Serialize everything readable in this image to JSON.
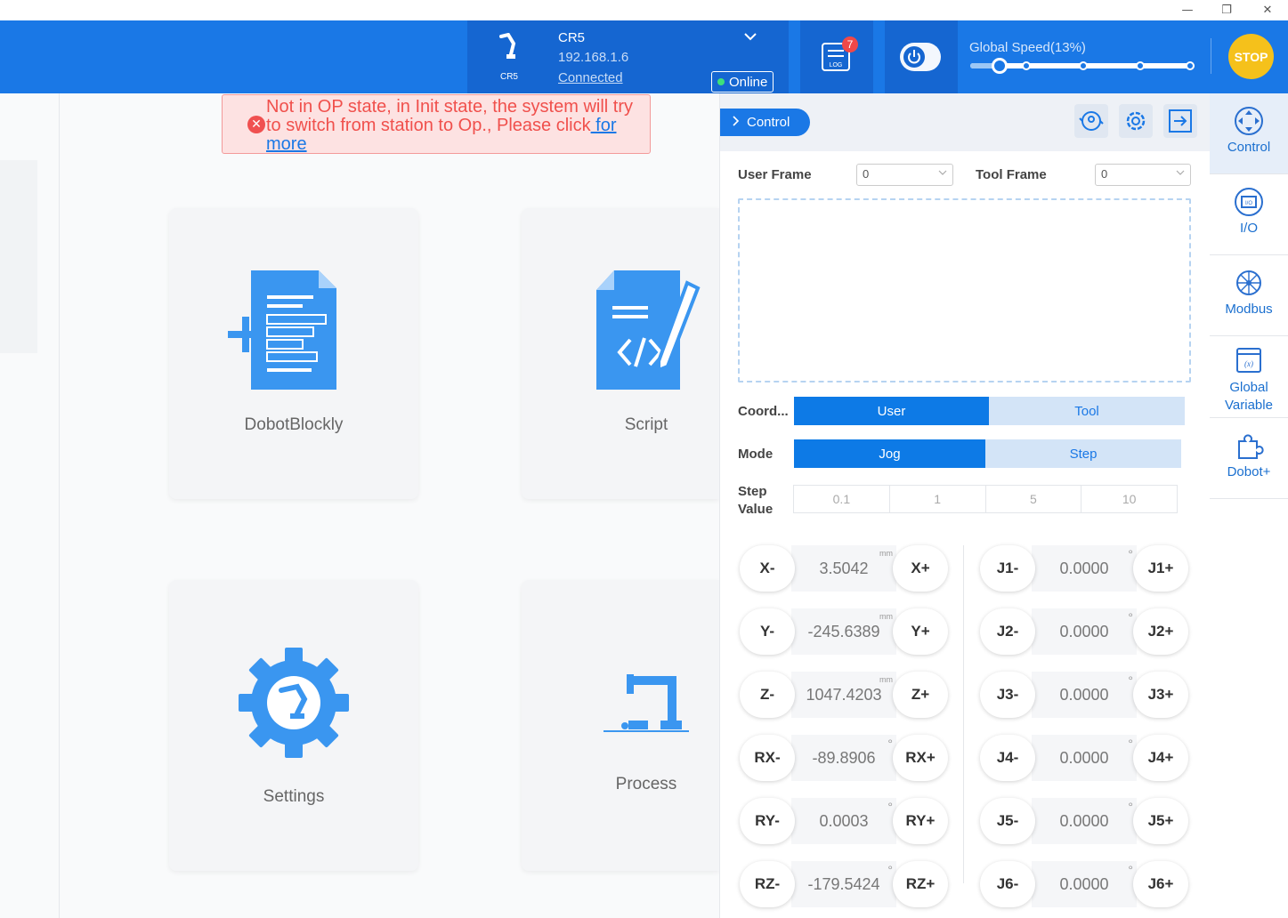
{
  "window": {
    "minimize": "—",
    "restore": "❐",
    "close": "✕"
  },
  "robot": {
    "model_small": "CR5",
    "name": "CR5",
    "ip": "192.168.1.6",
    "connection": "Connected",
    "status": "Online",
    "dropdown": "⌄"
  },
  "log": {
    "label": "LOG",
    "count": "7"
  },
  "speed": {
    "label": "Global Speed(13%)",
    "percent": 13
  },
  "stop_label": "STOP",
  "alert": {
    "text": "Not in OP state, in Init state, the system will try to switch from station to Op., Please click",
    "link": " for more",
    "icon": "✕"
  },
  "cards": {
    "blockly": "DobotBlockly",
    "script": "Script",
    "settings": "Settings",
    "process": "Process"
  },
  "control": {
    "tab_label": "Control",
    "user_frame_label": "User Frame",
    "user_frame_value": "0",
    "tool_frame_label": "Tool Frame",
    "tool_frame_value": "0",
    "coord_label": "Coord...",
    "coord_options": [
      "User",
      "Tool"
    ],
    "mode_label": "Mode",
    "mode_options": [
      "Jog",
      "Step"
    ],
    "step_label_1": "Step",
    "step_label_2": "Value",
    "step_values": [
      "0.1",
      "1",
      "5",
      "10"
    ],
    "cartesian": [
      {
        "minus": "X-",
        "value": "3.5042",
        "unit": "mm",
        "plus": "X+"
      },
      {
        "minus": "Y-",
        "value": "-245.6389",
        "unit": "mm",
        "plus": "Y+"
      },
      {
        "minus": "Z-",
        "value": "1047.4203",
        "unit": "mm",
        "plus": "Z+"
      },
      {
        "minus": "RX-",
        "value": "-89.8906",
        "unit": "°",
        "plus": "RX+"
      },
      {
        "minus": "RY-",
        "value": "0.0003",
        "unit": "°",
        "plus": "RY+"
      },
      {
        "minus": "RZ-",
        "value": "-179.5424",
        "unit": "°",
        "plus": "RZ+"
      }
    ],
    "joints": [
      {
        "minus": "J1-",
        "value": "0.0000",
        "unit": "°",
        "plus": "J1+"
      },
      {
        "minus": "J2-",
        "value": "0.0000",
        "unit": "°",
        "plus": "J2+"
      },
      {
        "minus": "J3-",
        "value": "0.0000",
        "unit": "°",
        "plus": "J3+"
      },
      {
        "minus": "J4-",
        "value": "0.0000",
        "unit": "°",
        "plus": "J4+"
      },
      {
        "minus": "J5-",
        "value": "0.0000",
        "unit": "°",
        "plus": "J5+"
      },
      {
        "minus": "J6-",
        "value": "0.0000",
        "unit": "°",
        "plus": "J6+"
      }
    ]
  },
  "nav": [
    {
      "label": "Control",
      "icon": "move-control-icon"
    },
    {
      "label": "I/O",
      "icon": "io-icon"
    },
    {
      "label": "Modbus",
      "icon": "modbus-icon"
    },
    {
      "label": "Global\nVariable",
      "icon": "variable-icon"
    },
    {
      "label": "Dobot+",
      "icon": "puzzle-icon"
    }
  ],
  "colors": {
    "primary": "#1a78e6",
    "header": "#1566d1",
    "stop": "#f5c11b",
    "alert": "#f0504c"
  }
}
